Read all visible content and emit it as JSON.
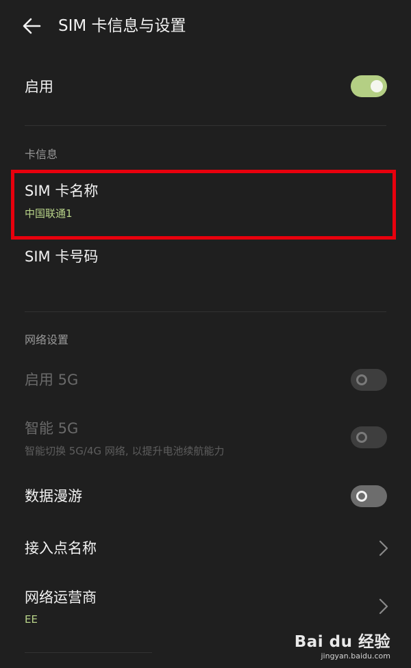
{
  "header": {
    "title": "SIM 卡信息与设置"
  },
  "enable": {
    "label": "启用",
    "on": true
  },
  "card_info": {
    "section_label": "卡信息",
    "sim_name": {
      "label": "SIM 卡名称",
      "value": "中国联通1"
    },
    "sim_number": {
      "label": "SIM 卡号码"
    }
  },
  "network": {
    "section_label": "网络设置",
    "enable_5g": {
      "label": "启用 5G",
      "on": false,
      "disabled": true
    },
    "smart_5g": {
      "label": "智能 5G",
      "description": "智能切换 5G/4G 网络, 以提升电池续航能力",
      "on": false,
      "disabled": true
    },
    "roaming": {
      "label": "数据漫游",
      "on": false
    },
    "apn": {
      "label": "接入点名称"
    },
    "operator": {
      "label": "网络运营商",
      "value": "EE"
    }
  },
  "watermark": {
    "logo": "Bai du 经验",
    "url": "jingyan.baidu.com"
  },
  "colors": {
    "background": "#1f1f1f",
    "accent": "#b4cf84",
    "highlight": "#e8000d"
  }
}
